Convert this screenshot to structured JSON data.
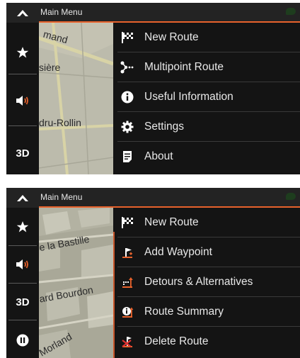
{
  "screen1": {
    "title": "Main Menu",
    "sidebar": {
      "favorites_icon": "star-icon",
      "sound_icon": "speaker-icon",
      "view_label": "3D"
    },
    "map_labels": [
      "mand",
      "sière",
      "dru-Rollin"
    ],
    "menu": [
      {
        "label": "New Route",
        "icon": "checkered-flag-icon"
      },
      {
        "label": "Multipoint Route",
        "icon": "multipoint-icon"
      },
      {
        "label": "Useful Information",
        "icon": "info-icon"
      },
      {
        "label": "Settings",
        "icon": "gear-icon"
      },
      {
        "label": "About",
        "icon": "document-icon"
      }
    ]
  },
  "screen2": {
    "title": "Main Menu",
    "sidebar": {
      "favorites_icon": "star-icon",
      "sound_icon": "speaker-icon",
      "view_label": "3D",
      "pause_icon": "pause-icon"
    },
    "map_labels": [
      "e la Bastille",
      "ard Bourdon",
      "Morland"
    ],
    "menu": [
      {
        "label": "New Route",
        "icon": "checkered-flag-icon"
      },
      {
        "label": "Add Waypoint",
        "icon": "add-waypoint-icon"
      },
      {
        "label": "Detours & Alternatives",
        "icon": "detours-icon"
      },
      {
        "label": "Route Summary",
        "icon": "route-summary-icon"
      },
      {
        "label": "Delete Route",
        "icon": "delete-route-icon"
      }
    ]
  },
  "colors": {
    "accent": "#e8622c",
    "background": "#141414",
    "text": "#e8e8e8"
  }
}
